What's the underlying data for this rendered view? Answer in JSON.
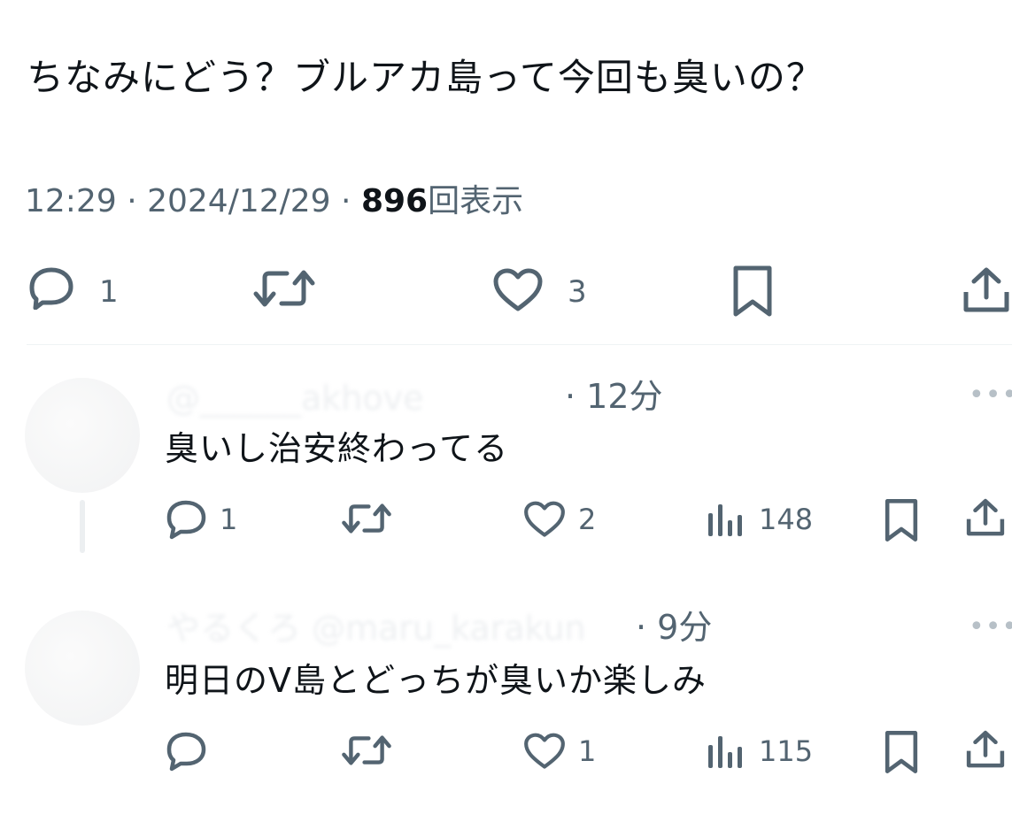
{
  "tweet": {
    "text": "ちなみにどう？ブルアカ島って今回も臭いの？",
    "time": "12:29",
    "sep1": " · ",
    "date": "2024/12/29",
    "sep2": " · ",
    "views": "896",
    "views_label": "回表示",
    "reply_count": "1",
    "like_count": "3"
  },
  "replies": [
    {
      "handle_blurred": "@______akhove",
      "sep": " · ",
      "time": "12分",
      "text": "臭いし治安終わってる",
      "reply_count": "1",
      "like_count": "2",
      "view_count": "148",
      "more": "•••"
    },
    {
      "handle_blurred": "やるくろ @maru_karakun",
      "sep": " · ",
      "time": "9分",
      "text": "明日のV島とどっちが臭いか楽しみ",
      "like_count": "1",
      "view_count": "115",
      "more": "•••"
    }
  ],
  "colors": {
    "text": "#0f1419",
    "secondary": "#536471",
    "divider": "#eff3f4"
  },
  "icons": [
    "reply-icon",
    "retweet-icon",
    "like-icon",
    "bookmark-icon",
    "share-icon",
    "views-icon",
    "more-icon"
  ]
}
